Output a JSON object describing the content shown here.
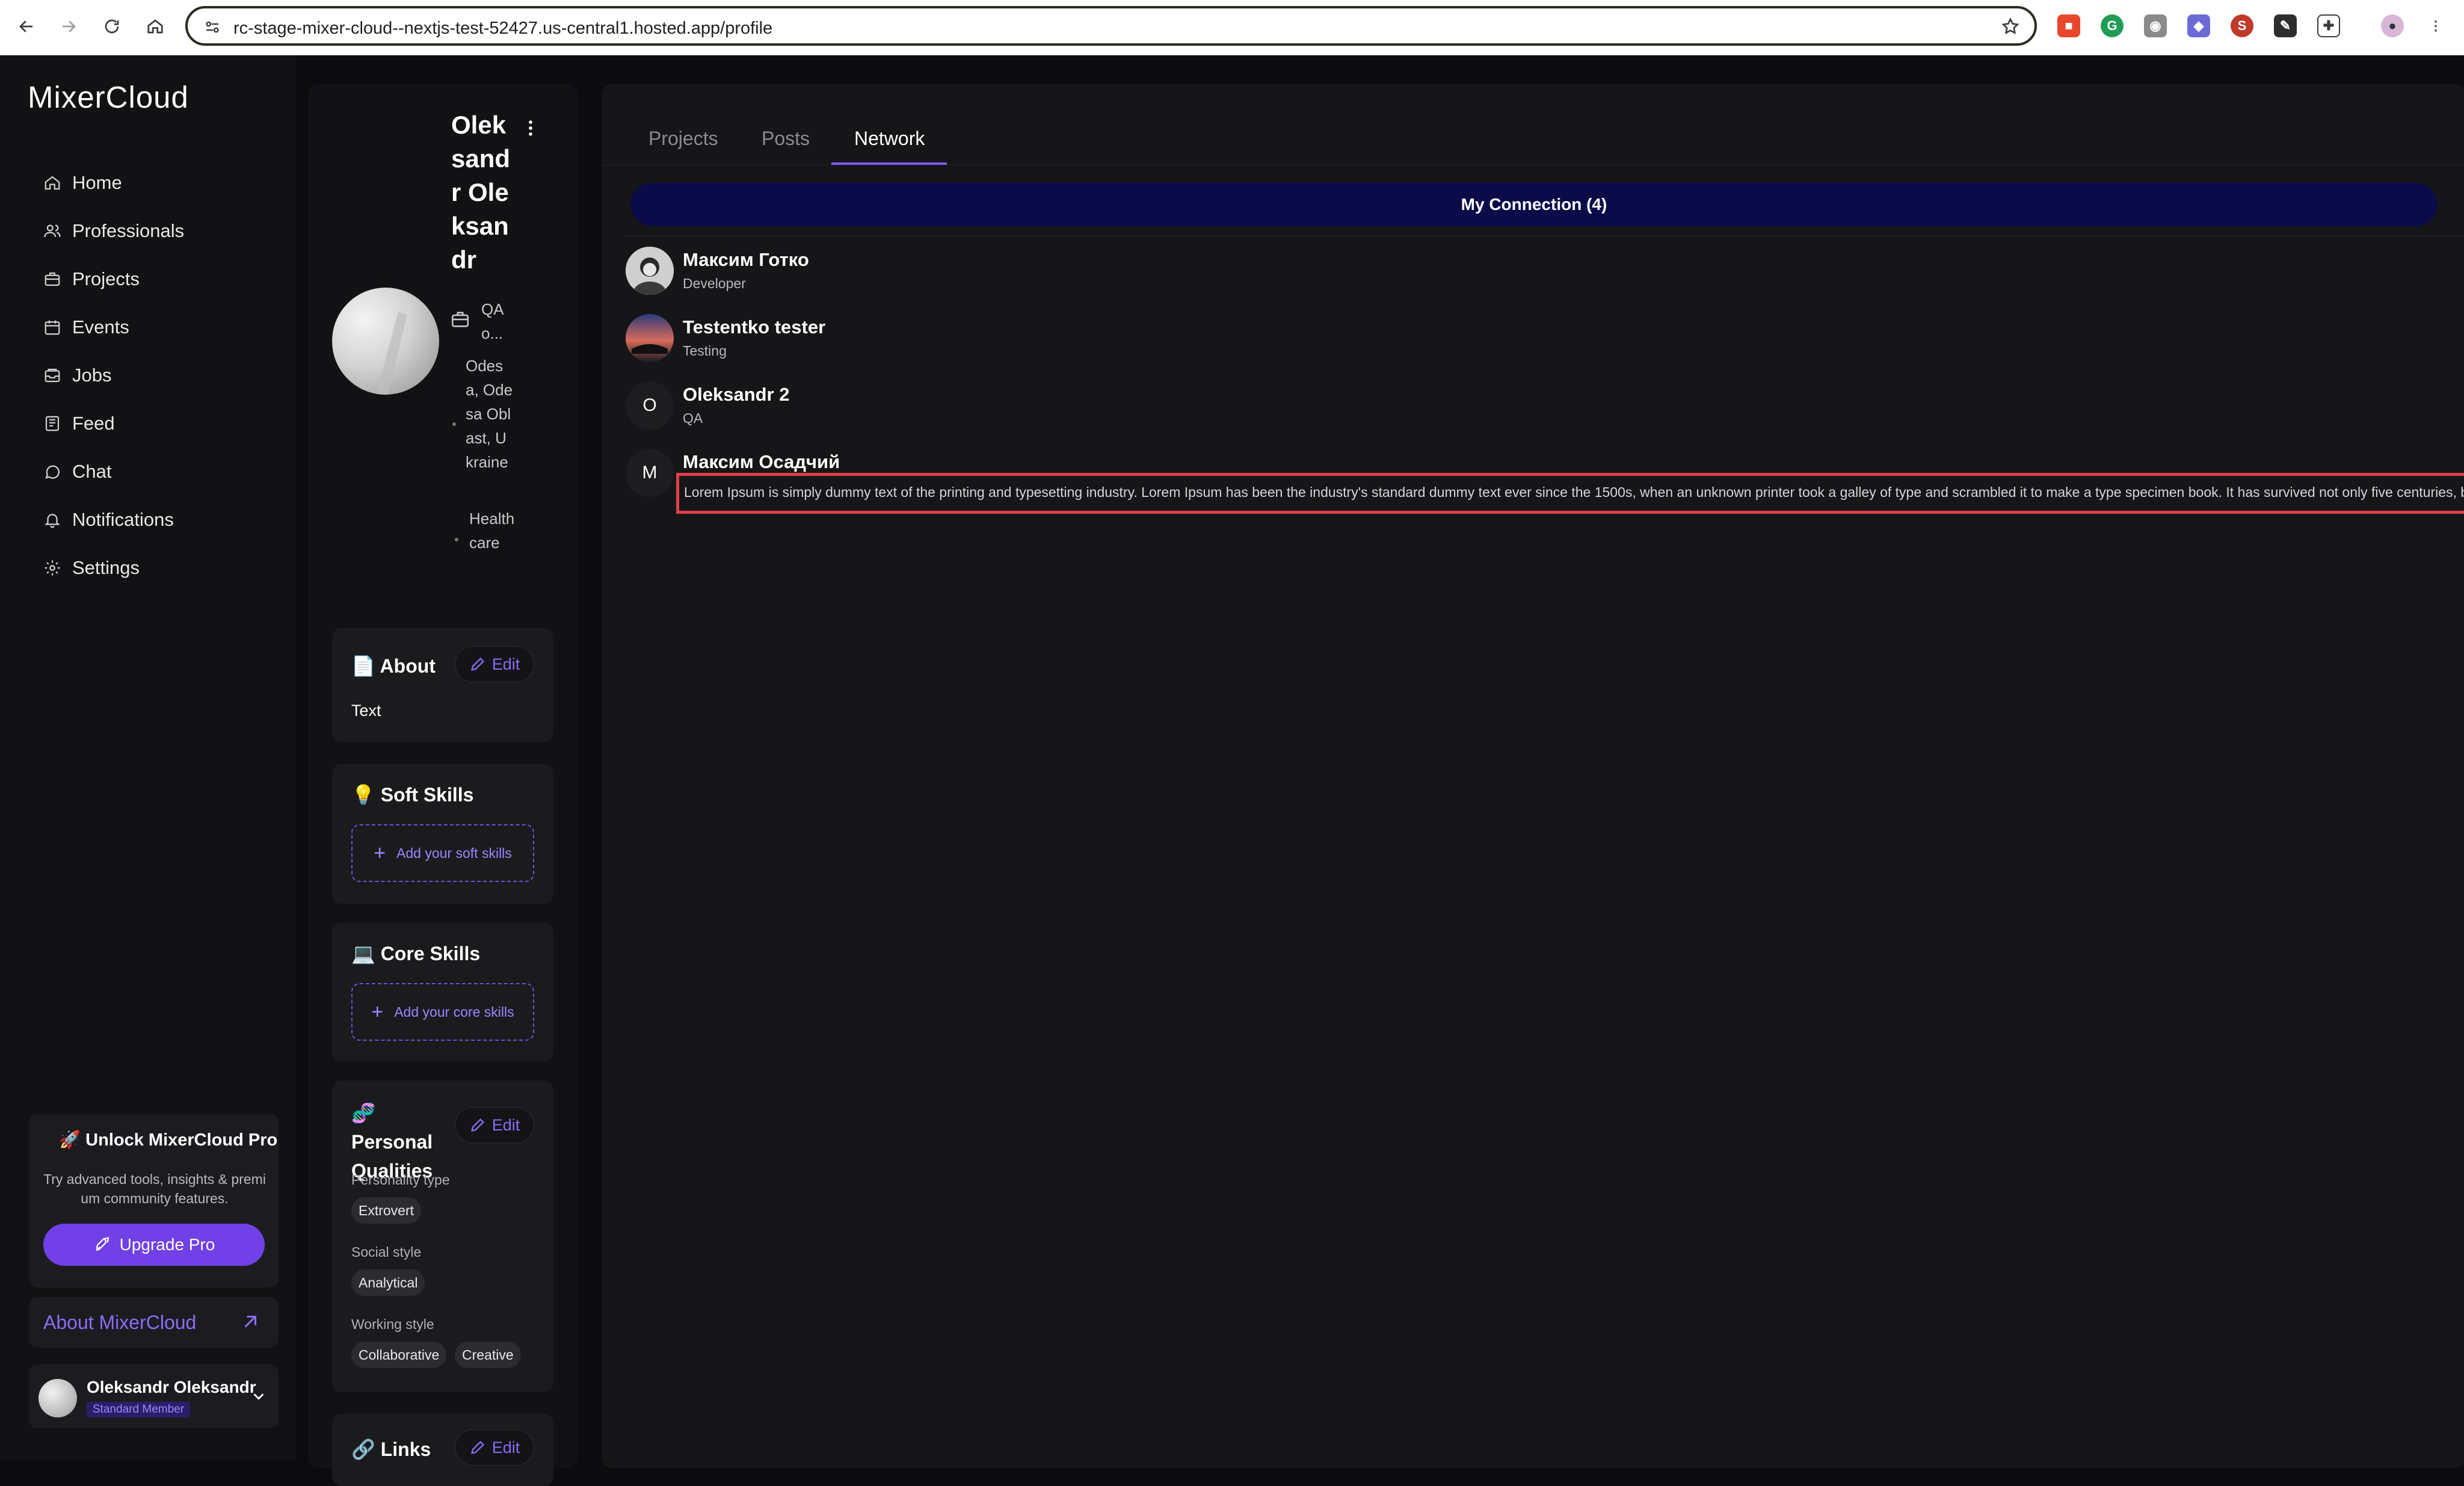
{
  "browser": {
    "url": "rc-stage-mixer-cloud--nextjs-test-52427.us-central1.hosted.app/profile"
  },
  "sidebar": {
    "logo": "MixerCloud",
    "items": [
      {
        "label": "Home",
        "icon": "home-icon"
      },
      {
        "label": "Professionals",
        "icon": "users-icon"
      },
      {
        "label": "Projects",
        "icon": "briefcase-icon"
      },
      {
        "label": "Events",
        "icon": "calendar-icon"
      },
      {
        "label": "Jobs",
        "icon": "inbox-icon"
      },
      {
        "label": "Feed",
        "icon": "newspaper-icon"
      },
      {
        "label": "Chat",
        "icon": "chat-icon"
      },
      {
        "label": "Notifications",
        "icon": "bell-icon"
      },
      {
        "label": "Settings",
        "icon": "gear-icon"
      }
    ],
    "promo": {
      "title": "🚀 Unlock MixerCloud Pro",
      "text": "Try advanced tools, insights & premi um community features.",
      "button": "Upgrade Pro"
    },
    "about_link": "About MixerCloud",
    "user": {
      "name": "Oleksandr Oleksandr",
      "badge": "Standard Member"
    }
  },
  "profile": {
    "name": "Oleksandr Oleksandr",
    "role": "QA o...",
    "location": "Odesa, Odesa Oblast, Ukraine",
    "industry": "Healthcare",
    "about": {
      "title": "📄 About",
      "edit": "Edit",
      "text": "Text"
    },
    "soft_skills": {
      "title": "💡 Soft Skills",
      "add": "Add your soft skills"
    },
    "core_skills": {
      "title": "💻 Core Skills",
      "add": "Add your core skills"
    },
    "personal_qualities": {
      "title": "🧬 Personal Qualities",
      "edit": "Edit",
      "personality_label": "Personality type",
      "personality": "Extrovert",
      "social_label": "Social style",
      "social": "Analytical",
      "working_label": "Working style",
      "working": [
        "Collaborative",
        "Creative"
      ]
    },
    "links": {
      "title": "🔗 Links",
      "edit": "Edit"
    }
  },
  "main": {
    "tabs": [
      {
        "label": "Projects",
        "active": false
      },
      {
        "label": "Posts",
        "active": false
      },
      {
        "label": "Network",
        "active": true
      }
    ],
    "connections_header": "My Connection (4)",
    "connections": [
      {
        "name": "Максим Готко",
        "role": "Developer",
        "avatar": "photo"
      },
      {
        "name": "Testentko tester",
        "role": "Testing",
        "avatar": "photo"
      },
      {
        "name": "Oleksandr 2",
        "role": "QA",
        "avatar": "O"
      },
      {
        "name": "Максим Осадчий",
        "role": "Lorem Ipsum is simply dummy text of the printing and typesetting industry. Lorem Ipsum has been the industry's standard dummy text ever since the 1500s, when an unknown printer took a galley of type and scrambled it to make a type specimen book. It has survived not only five centuries, but also t",
        "avatar": "M"
      }
    ]
  },
  "colors": {
    "accent": "#7c5cf0",
    "connection_bar": "#0b0b4a",
    "highlight": "#e0404a"
  }
}
